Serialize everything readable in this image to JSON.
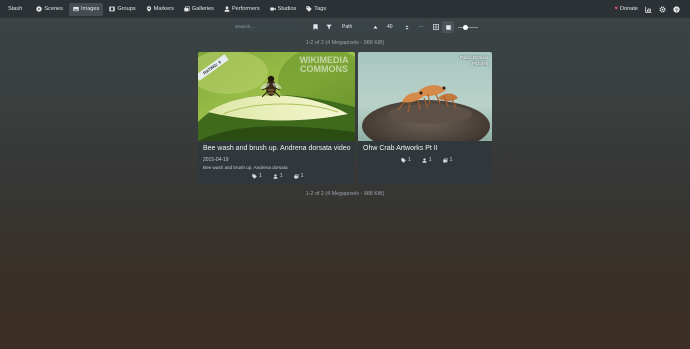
{
  "nav": {
    "brand": "Stash",
    "items": [
      {
        "label": "Scenes",
        "icon": "play-circle-icon",
        "active": false
      },
      {
        "label": "Images",
        "icon": "image-icon",
        "active": true
      },
      {
        "label": "Groups",
        "icon": "film-icon",
        "active": false
      },
      {
        "label": "Markers",
        "icon": "map-marker-icon",
        "active": false
      },
      {
        "label": "Galleries",
        "icon": "images-icon",
        "active": false
      },
      {
        "label": "Performers",
        "icon": "user-icon",
        "active": false
      },
      {
        "label": "Studios",
        "icon": "video-icon",
        "active": false
      },
      {
        "label": "Tags",
        "icon": "tag-icon",
        "active": false
      }
    ],
    "donate_label": "Donate"
  },
  "toolbar": {
    "search_placeholder": "Search…",
    "sort_field": "Path",
    "per_page": "40",
    "dots": "···",
    "zoom_level": 0.35
  },
  "summary": "1-2 of 2 (4 Megapixels - 988 KiB)",
  "cards": [
    {
      "title": "Bee wash and brush up. Andrena dorsata video",
      "date": "2015-04-19",
      "description": "Bee wash and brush up. Andrena dorsata",
      "rating_banner": "RATING: 4",
      "watermark": "WIKIMEDIA COMMONS",
      "tags": "1",
      "performers": "1",
      "galleries": "1"
    },
    {
      "title": "Ohw Crab Artworks Pt II",
      "studio_line1": "Public Domain",
      "studio_line2": "Pictures",
      "tags": "1",
      "performers": "1",
      "galleries": "1"
    }
  ]
}
